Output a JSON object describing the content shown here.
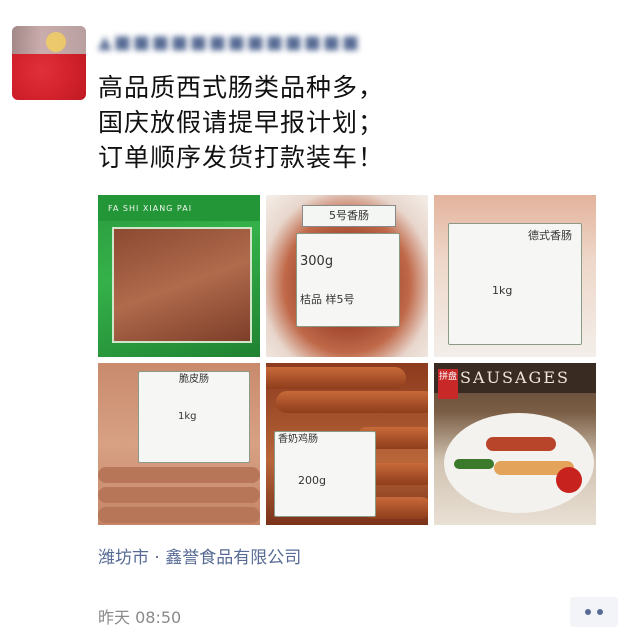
{
  "post": {
    "avatar_icon": "avatar-image",
    "nickname": "▲■■■■■■■■■■■■■",
    "text_lines": [
      "高品质西式肠类品种多，",
      "国庆放假请提早报计划；",
      "订单顺序发货打款装车！"
    ],
    "photos": [
      {
        "name": "green-sausage-pack",
        "brand_text": "FA SHI XIANG PAI"
      },
      {
        "name": "no5-sausage-pack",
        "title": "5号香肠",
        "weight": "300g",
        "note": "桔品 样5号"
      },
      {
        "name": "dehua-sausage-pack",
        "title": "德式香肠",
        "weight": "1kg"
      },
      {
        "name": "crisp-sausage-pack",
        "title": "脆皮肠",
        "weight": "1kg"
      },
      {
        "name": "cheese-chicken-sausage-pack",
        "title": "香奶鸡肠",
        "weight": "200g"
      },
      {
        "name": "sausage-platter",
        "banner": "SAUSAGES",
        "tag": "拼盘"
      }
    ],
    "location": "潍坊市 · 鑫誉食品有限公司",
    "time": "昨天 08:50",
    "more_icon": "more-dots-icon"
  }
}
